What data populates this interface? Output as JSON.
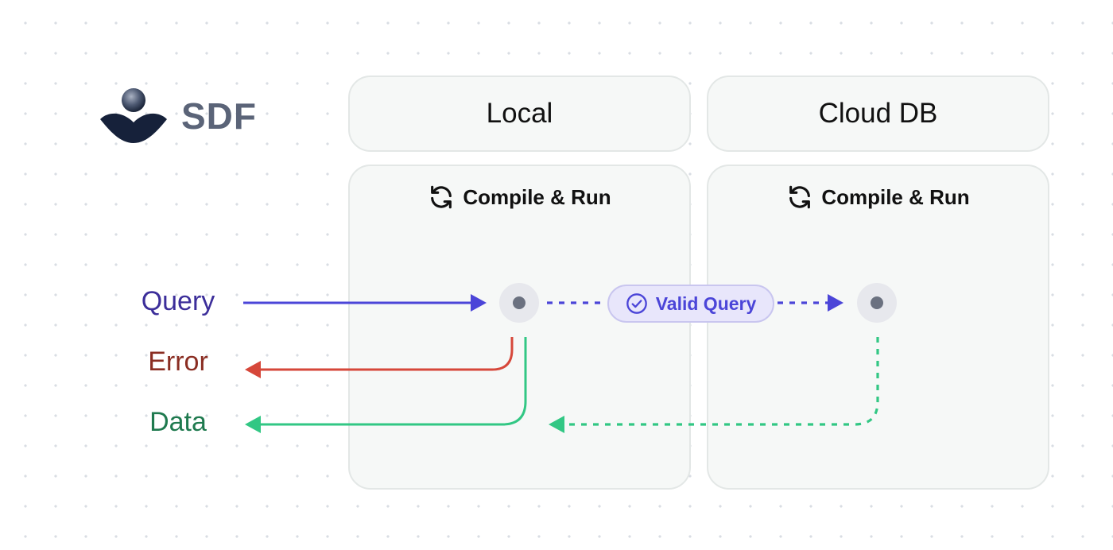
{
  "logo": {
    "text": "SDF"
  },
  "columns": [
    {
      "header": "Local",
      "subtitle": "Compile & Run"
    },
    {
      "header": "Cloud DB",
      "subtitle": "Compile & Run"
    }
  ],
  "flows": {
    "query": {
      "label": "Query",
      "color": "#3c2e9a",
      "arrow_color": "#4b45d8"
    },
    "error": {
      "label": "Error",
      "color": "#8a2d22",
      "arrow_color": "#d6473a"
    },
    "data": {
      "label": "Data",
      "color": "#1f7a4f",
      "arrow_color": "#32c784"
    }
  },
  "badge": {
    "label": "Valid Query",
    "icon": "check-circle-icon",
    "color": "#4b45d8"
  },
  "icons": {
    "compile": "refresh-icon"
  }
}
